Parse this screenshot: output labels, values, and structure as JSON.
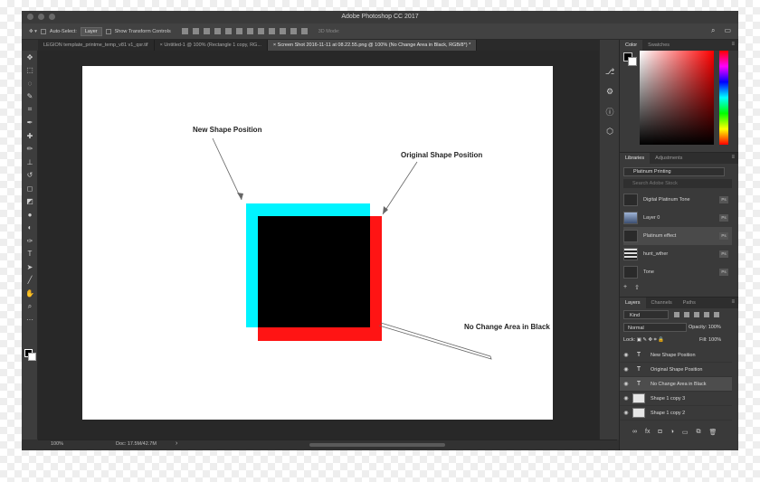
{
  "window": {
    "title": "Adobe Photoshop CC 2017"
  },
  "options_bar": {
    "move_icon": "move-icon",
    "auto_select_label": "Auto-Select:",
    "auto_select_value": "Layer",
    "transform_controls_label": "Show Transform Controls",
    "mode_3d_label": "3D Mode:"
  },
  "tabs": [
    {
      "label": "LEGION template_printme_temp_v81 v1_qsr.tif"
    },
    {
      "label": "Untitled-1 @ 100% (Rectangle 1 copy, RG..."
    },
    {
      "label": "Screen Shot 2016-11-11 at 08.22.55.png @ 100% (No Change Area in Black, RGB/8*) *"
    }
  ],
  "tools": [
    "move-icon",
    "marquee-icon",
    "lasso-icon",
    "quick-select-icon",
    "crop-icon",
    "eyedropper-icon",
    "healing-icon",
    "brush-icon",
    "stamp-icon",
    "history-brush-icon",
    "eraser-icon",
    "gradient-icon",
    "blur-icon",
    "dodge-icon",
    "pen-icon",
    "type-icon",
    "path-select-icon",
    "line-icon",
    "hand-icon",
    "zoom-icon",
    "more-icon"
  ],
  "tool_glyphs": [
    "✥",
    "⬚",
    "◌",
    "✎",
    "⌗",
    "✒",
    "✚",
    "✏",
    "⊥",
    "↺",
    "◻",
    "◩",
    "●",
    "◐",
    "✑",
    "T",
    "➤",
    "╱",
    "✋",
    "⌕",
    "···"
  ],
  "canvas": {
    "annotations": {
      "new_shape": "New Shape Position",
      "original_shape": "Original Shape Position",
      "no_change": "No Change Area in Black"
    },
    "colors": {
      "cyan": "#00f4ff",
      "red": "#ff1414",
      "black": "#000000"
    }
  },
  "status": {
    "zoom": "100%",
    "doc": "Doc: 17.5M/42.7M"
  },
  "color_panel": {
    "tabs": [
      "Color",
      "Swatches"
    ]
  },
  "libraries_panel": {
    "tabs": [
      "Libraries",
      "Adjustments"
    ],
    "library": "Platinum Printing",
    "search_placeholder": "Search Adobe Stock",
    "items": [
      {
        "label": "Digital Platinum Tone",
        "thumb": "",
        "badge": "Ps"
      },
      {
        "label": "Layer 0",
        "thumb": "img",
        "badge": "Ps"
      },
      {
        "label": "Platinum effect",
        "thumb": "",
        "badge": "Ps"
      },
      {
        "label": "hunt_wther",
        "thumb": "bars",
        "badge": "Ps"
      },
      {
        "label": "Tone",
        "thumb": "",
        "badge": "Ps"
      }
    ]
  },
  "layers_panel": {
    "tabs": [
      "Layers",
      "Channels",
      "Paths"
    ],
    "kind": "Kind",
    "blend_mode": "Normal",
    "opacity_label": "Opacity:",
    "opacity_value": "100%",
    "lock_label": "Lock:",
    "fill_label": "Fill:",
    "fill_value": "100%",
    "layers": [
      {
        "name": "New Shape Position",
        "type": "text",
        "glyph": "T"
      },
      {
        "name": "Original Shape Position",
        "type": "text",
        "glyph": "T"
      },
      {
        "name": "No Change Area in Black",
        "type": "text",
        "glyph": "T"
      },
      {
        "name": "Shape 1 copy 3",
        "type": "shape",
        "glyph": ""
      },
      {
        "name": "Shape 1 copy 2",
        "type": "shape",
        "glyph": ""
      }
    ]
  }
}
